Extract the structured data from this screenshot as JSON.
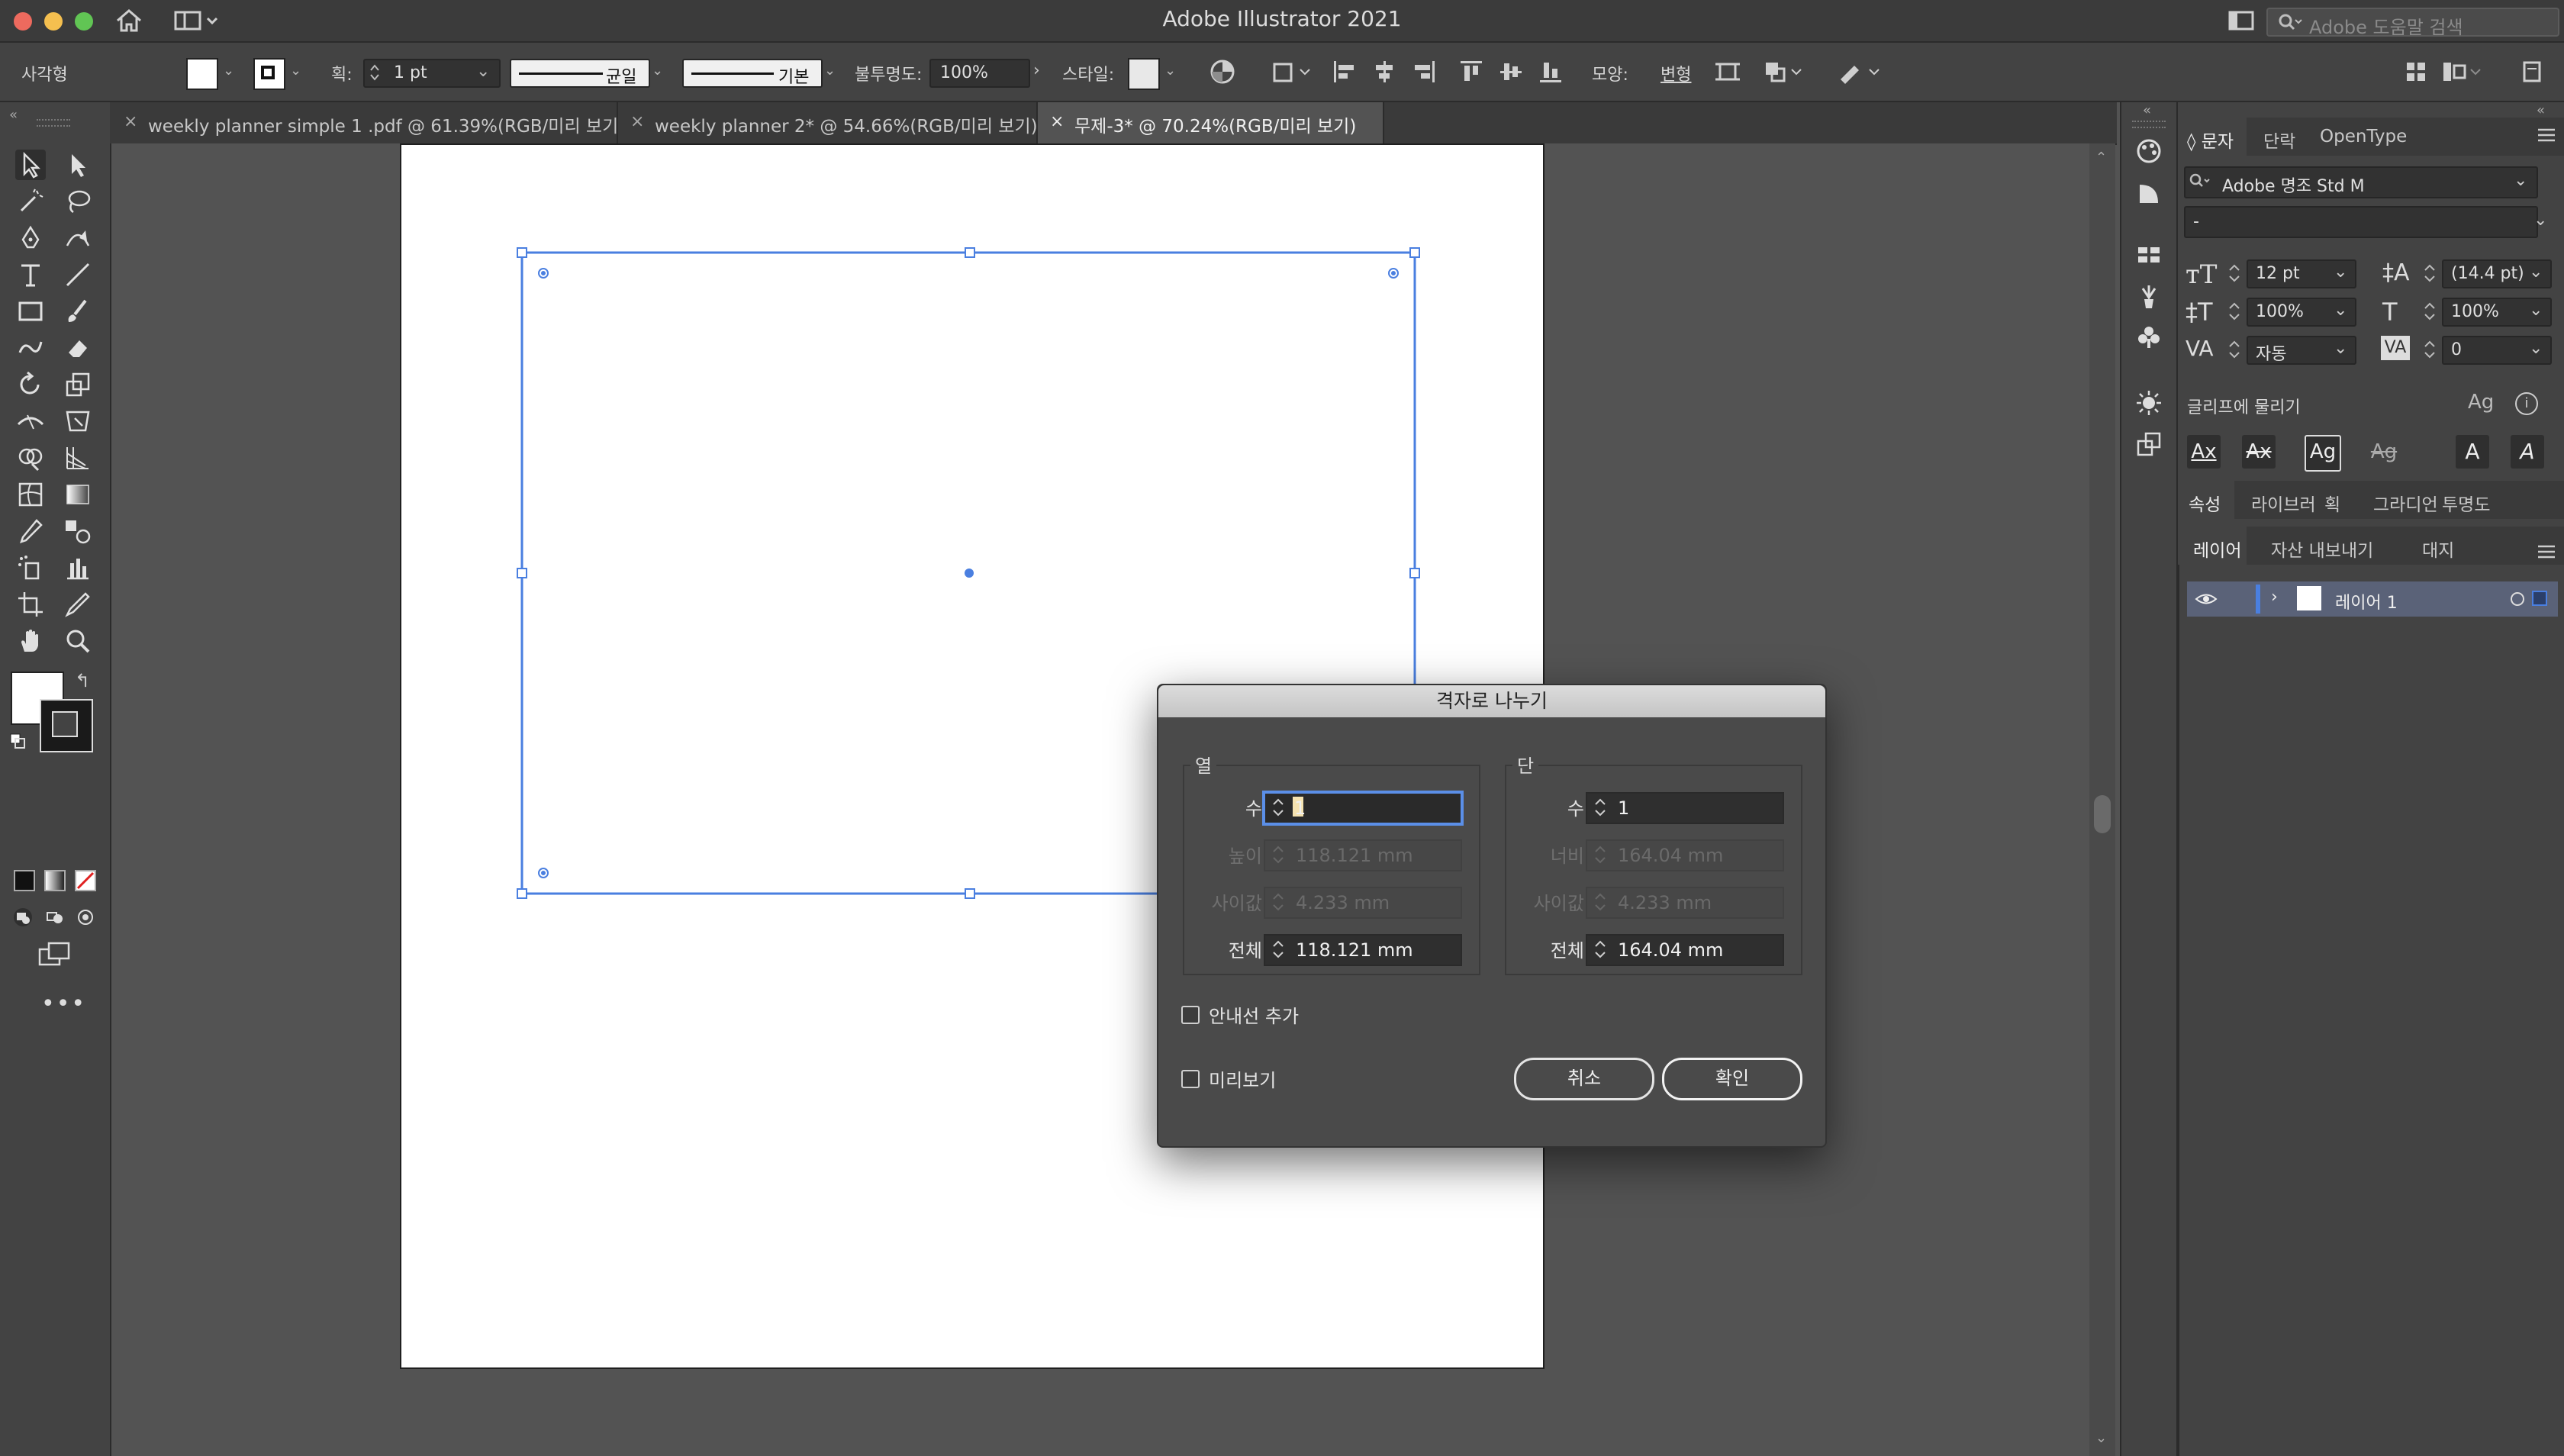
{
  "window": {
    "title": "Adobe Illustrator 2021",
    "help_search_placeholder": "Adobe 도움말 검색"
  },
  "controlbar": {
    "object_type": "사각형",
    "stroke_label": "획:",
    "stroke_weight": "1 pt",
    "stroke_profile": "균일",
    "brush_style": "기본",
    "opacity_label": "불투명도:",
    "opacity_value": "100%",
    "style_label": "스타일:",
    "shape_label": "모양:",
    "transform_label": "변형"
  },
  "tabs": [
    {
      "label": "weekly planner simple 1 .pdf @ 61.39%(RGB/미리 보기)",
      "active": false
    },
    {
      "label": "weekly planner 2* @ 54.66%(RGB/미리 보기)",
      "active": false
    },
    {
      "label": "무제-3* @ 70.24%(RGB/미리 보기)",
      "active": true
    }
  ],
  "character_panel": {
    "tabs": [
      "문자",
      "단락",
      "OpenType"
    ],
    "font_family": "Adobe 명조 Std M",
    "font_style": "-",
    "font_size": "12 pt",
    "leading": "(14.4 pt)",
    "vertical_scale": "100%",
    "horizontal_scale": "100%",
    "kerning": "자동",
    "tracking": "0",
    "snap_to_glyph": "글리프에 물리기"
  },
  "properties_tabs": [
    "속성",
    "라이브러",
    "획",
    "그라디언",
    "투명도"
  ],
  "layers_panel": {
    "tabs": [
      "레이어",
      "자산 내보내기",
      "대지"
    ],
    "layers": [
      {
        "name": "레이어 1"
      }
    ]
  },
  "dialog": {
    "title": "격자로 나누기",
    "rows": {
      "title": "열",
      "number_label": "수:",
      "number_value": "1",
      "size_label": "높이:",
      "size_value": "118.121 mm",
      "gutter_label": "사이값:",
      "gutter_value": "4.233 mm",
      "total_label": "전체:",
      "total_value": "118.121 mm"
    },
    "columns": {
      "title": "단",
      "number_label": "수:",
      "number_value": "1",
      "size_label": "너비:",
      "size_value": "164.04 mm",
      "gutter_label": "사이값:",
      "gutter_value": "4.233 mm",
      "total_label": "전체:",
      "total_value": "164.04 mm"
    },
    "add_guides_label": "안내선 추가",
    "preview_label": "미리보기",
    "cancel_label": "취소",
    "ok_label": "확인"
  }
}
